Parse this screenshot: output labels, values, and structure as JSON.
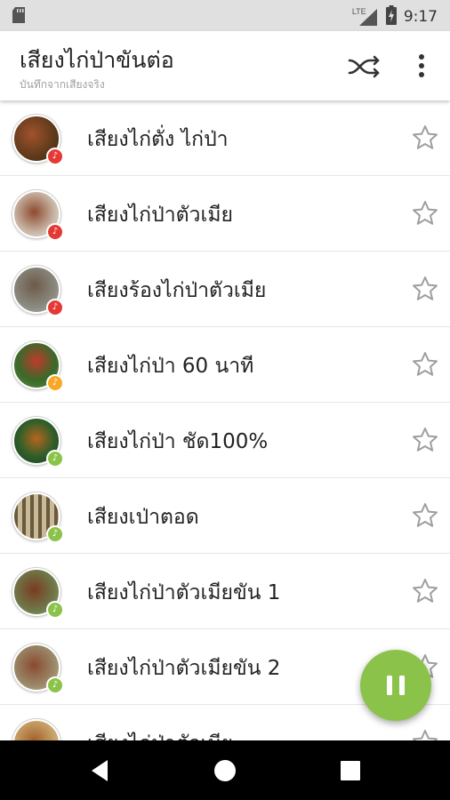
{
  "status_bar": {
    "network": "LTE",
    "time": "9:17"
  },
  "app_bar": {
    "title": "เสียงไก่ป่าขันต่อ",
    "subtitle": "บันทึกจากเสียงจริง",
    "actions": [
      "shuffle-icon",
      "more-vert-icon"
    ]
  },
  "items": [
    {
      "label": "เสียงไก่ตั่ง ไก่ป่า",
      "badge_color": "#e53935"
    },
    {
      "label": "เสียงไก่ป่าตัวเมีย",
      "badge_color": "#e53935"
    },
    {
      "label": "เสียงร้องไก่ป่าตัวเมีย",
      "badge_color": "#e53935"
    },
    {
      "label": "เสียงไก่ป่า 60 นาที",
      "badge_color": "#f9a825"
    },
    {
      "label": "เสียงไก่ป่า ชัด100%",
      "badge_color": "#8bc34a"
    },
    {
      "label": "เสียงเป่าตอด",
      "badge_color": "#8bc34a"
    },
    {
      "label": "เสียงไก่ป่าตัวเมียขัน 1",
      "badge_color": "#8bc34a"
    },
    {
      "label": "เสียงไก่ป่าตัวเมียขัน 2",
      "badge_color": "#8bc34a"
    },
    {
      "label": "เสียงไก่ป่าตัวเมีย",
      "badge_color": "#8bc34a"
    }
  ],
  "fab": {
    "icon": "pause-icon",
    "color": "#8bc34a"
  },
  "nav_bar": {
    "buttons": [
      "back-icon",
      "home-icon",
      "recents-icon"
    ]
  }
}
